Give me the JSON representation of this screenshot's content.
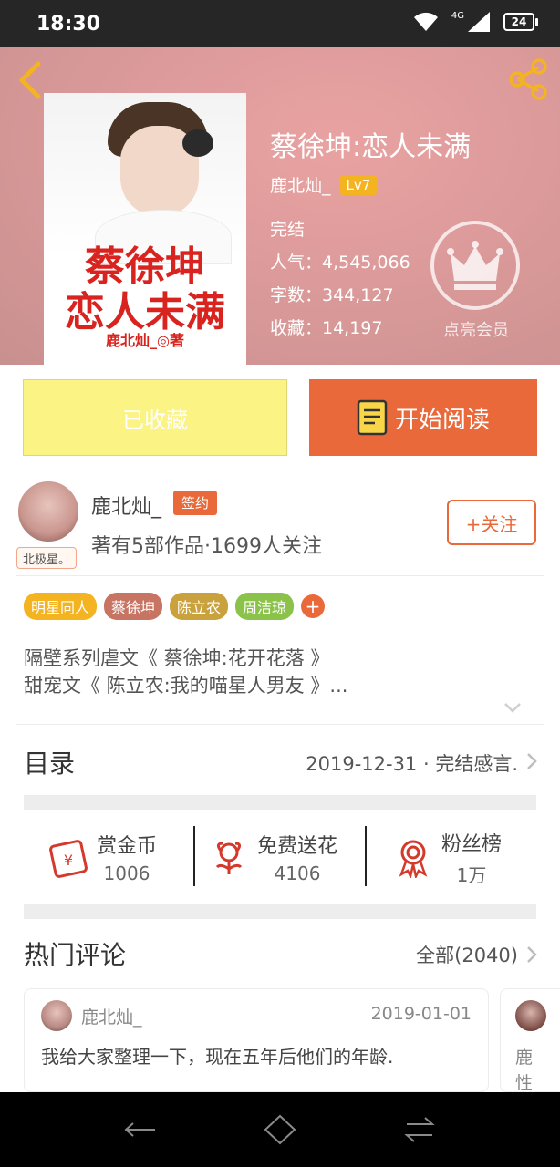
{
  "status_bar": {
    "time": "18:30",
    "network": "4G",
    "battery": "24"
  },
  "book": {
    "title": "蔡徐坤:恋人未满",
    "author": "鹿北灿_",
    "author_level": "Lv7",
    "status": "完结",
    "popularity": "人气：4,545,066",
    "word_count": "字数：344,127",
    "favorites": "收藏：14,197",
    "cover": {
      "title_line1": "蔡徐坤",
      "title_line2": "恋人未满",
      "byline": "鹿北灿_◎著"
    }
  },
  "membership": {
    "label": "点亮会员"
  },
  "actions": {
    "collected_label": "已收藏",
    "read_label": "开始阅读"
  },
  "author_card": {
    "name": "鹿北灿_",
    "badge": "签约",
    "meta": "著有5部作品·1699人关注",
    "avatar_tag": "北极星。",
    "follow_label": "+关注"
  },
  "tags": [
    {
      "label": "明星同人",
      "color": "#f4b321"
    },
    {
      "label": "蔡徐坤",
      "color": "#c77463"
    },
    {
      "label": "陈立农",
      "color": "#c9a23e"
    },
    {
      "label": "周洁琼",
      "color": "#8bc34a"
    }
  ],
  "tag_plus": "+",
  "description": {
    "line1": "隔壁系列虐文《 蔡徐坤:花开花落 》",
    "line2": "甜宠文《 陈立农:我的喵星人男友 》..."
  },
  "toc": {
    "title": "目录",
    "latest": "2019-12-31 · 完结感言."
  },
  "gifts": [
    {
      "label": "赏金币",
      "value": "1006",
      "icon": "coin-envelope-icon"
    },
    {
      "label": "免费送花",
      "value": "4106",
      "icon": "flower-icon"
    },
    {
      "label": "粉丝榜",
      "value": "1万",
      "icon": "medal-icon"
    }
  ],
  "hot_comments": {
    "title": "热门评论",
    "all_label": "全部(2040)",
    "items": [
      {
        "user": "鹿北灿_",
        "date": "2019-01-01",
        "text": "我给大家整理一下，现在五年后他们的年龄."
      },
      {
        "user_line1": "鹿",
        "user_line2": "性"
      }
    ]
  },
  "colors": {
    "accent": "#e9693a",
    "collected_bg": "#fbf383",
    "hero": "#dc9a9a",
    "level": "#f4b321"
  }
}
